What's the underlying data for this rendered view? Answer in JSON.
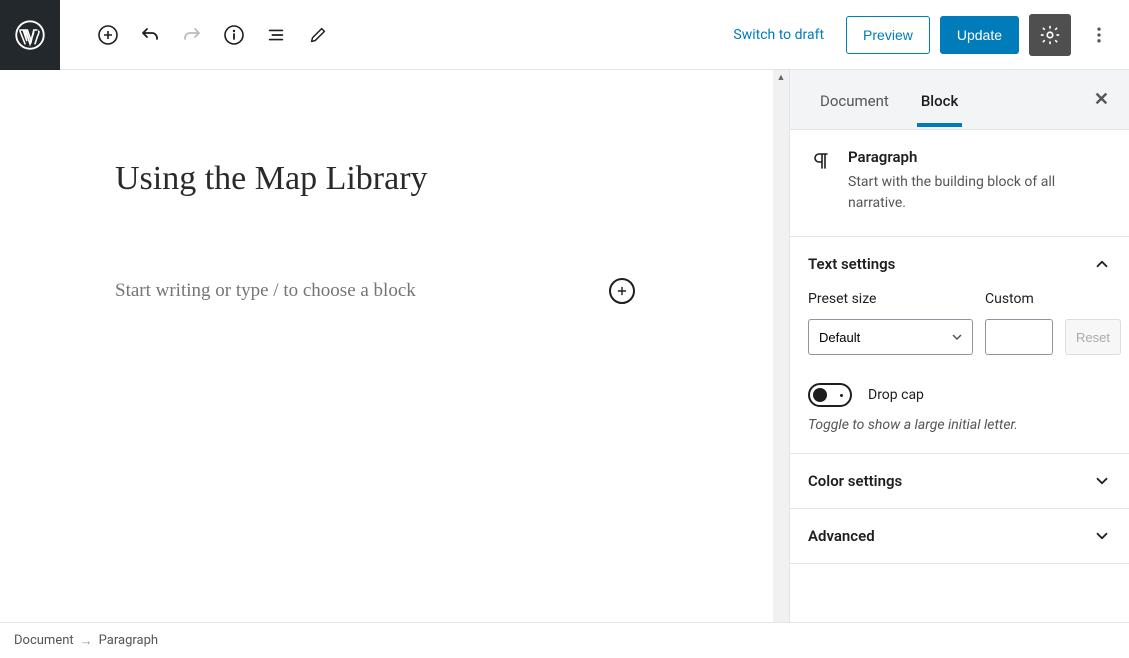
{
  "toolbar": {
    "switch_to_draft": "Switch to draft",
    "preview": "Preview",
    "update": "Update"
  },
  "editor": {
    "title": "Using the Map Library",
    "paragraph_placeholder": "Start writing or type / to choose a block"
  },
  "sidebar": {
    "tabs": {
      "document": "Document",
      "block": "Block"
    },
    "block_header": {
      "name": "Paragraph",
      "description": "Start with the building block of all narrative."
    },
    "text_settings": {
      "title": "Text settings",
      "preset_label": "Preset size",
      "preset_value": "Default",
      "custom_label": "Custom",
      "custom_value": "",
      "reset": "Reset",
      "drop_cap_label": "Drop cap",
      "drop_cap_hint": "Toggle to show a large initial letter."
    },
    "color_settings": {
      "title": "Color settings"
    },
    "advanced": {
      "title": "Advanced"
    }
  },
  "breadcrumb": {
    "root": "Document",
    "separator": "→",
    "current": "Paragraph"
  }
}
